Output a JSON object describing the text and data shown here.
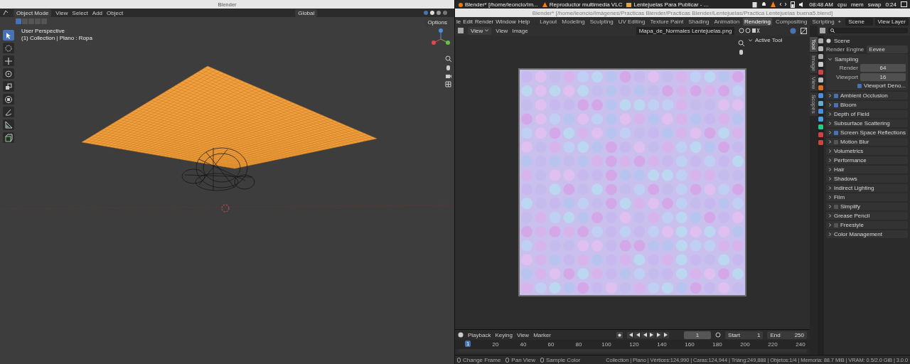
{
  "left_window": {
    "title": "Blender",
    "header": {
      "mode": "Object Mode",
      "menus": [
        "View",
        "Select",
        "Add",
        "Object"
      ],
      "orientation": "Global",
      "options": "Options"
    },
    "overlay": {
      "perspective": "User Perspective",
      "collection": "(1) Collection | Plano : Ropa"
    },
    "tools": [
      {
        "selected": true
      },
      {
        "selected": false
      },
      {
        "selected": false
      },
      {
        "selected": false
      },
      {
        "selected": false
      },
      {
        "selected": false
      },
      {
        "selected": false
      },
      {
        "selected": false
      },
      {
        "selected": false
      }
    ]
  },
  "taskbar": {
    "items": [
      "Blender* [/home/leoncio/Im...",
      "Reproductor multimedia VLC",
      "Lentejuelas Para Publicar - ..."
    ],
    "clock": "08:48 AM",
    "meters": [
      "cpu",
      "mem",
      "swap"
    ],
    "uptime": "0:24"
  },
  "right_window": {
    "title": "Blender* [/home/leoncio/Imágenes/Practicas Blender/Practicas Blender/Lentejuelas/Practica Lentejuelas buena5.blend]",
    "menus": [
      "le",
      "Edit",
      "Render",
      "Window",
      "Help"
    ],
    "workspaces": [
      {
        "label": "Layout",
        "selected": false
      },
      {
        "label": "Modeling",
        "selected": false
      },
      {
        "label": "Sculpting",
        "selected": false
      },
      {
        "label": "UV Editing",
        "selected": false
      },
      {
        "label": "Texture Paint",
        "selected": false
      },
      {
        "label": "Shading",
        "selected": false
      },
      {
        "label": "Animation",
        "selected": false
      },
      {
        "label": "Rendering",
        "selected": true
      },
      {
        "label": "Compositing",
        "selected": false
      },
      {
        "label": "Scripting",
        "selected": false
      }
    ],
    "add_tab": "+",
    "scene": "Scene",
    "view_layer": "View Layer"
  },
  "image_editor": {
    "mode": "View",
    "menus": [
      "View",
      "Image"
    ],
    "image_name": "Mapa_de_Normales Lentejuelas.png",
    "active_tool": "Active Tool",
    "sidebar_tabs": [
      {
        "label": "Tool",
        "selected": true
      },
      {
        "label": "Image",
        "selected": false
      },
      {
        "label": "View",
        "selected": false
      },
      {
        "label": "Scopes",
        "selected": false
      }
    ]
  },
  "properties": {
    "scene": "Scene",
    "render_engine_label": "Render Engine",
    "render_engine": "Eevee",
    "sampling": {
      "title": "Sampling",
      "expanded": true,
      "fields": [
        {
          "label": "Render",
          "value": "64"
        },
        {
          "label": "Viewport",
          "value": "16"
        }
      ],
      "denoise": {
        "label": "Viewport Deno...",
        "checked": true
      }
    },
    "panels": [
      {
        "title": "Ambient Occlusion",
        "kind": "checkbox",
        "checked": true
      },
      {
        "title": "Bloom",
        "kind": "checkbox",
        "checked": true
      },
      {
        "title": "Depth of Field",
        "kind": "plain"
      },
      {
        "title": "Subsurface Scattering",
        "kind": "plain"
      },
      {
        "title": "Screen Space Reflections",
        "kind": "checkbox",
        "checked": true
      },
      {
        "title": "Motion Blur",
        "kind": "checkbox",
        "checked": false
      },
      {
        "title": "Volumetrics",
        "kind": "plain"
      },
      {
        "title": "Performance",
        "kind": "plain"
      },
      {
        "title": "Hair",
        "kind": "plain"
      },
      {
        "title": "Shadows",
        "kind": "plain"
      },
      {
        "title": "Indirect Lighting",
        "kind": "plain"
      },
      {
        "title": "Film",
        "kind": "plain"
      },
      {
        "title": "Simplify",
        "kind": "checkbox",
        "checked": false
      },
      {
        "title": "Grease Pencil",
        "kind": "plain"
      },
      {
        "title": "Freestyle",
        "kind": "checkbox",
        "checked": false
      },
      {
        "title": "Color Management",
        "kind": "plain"
      }
    ]
  },
  "timeline": {
    "menus": [
      "Playback",
      "Keying",
      "View",
      "Marker"
    ],
    "current_frame": "1",
    "start_label": "Start",
    "start": "1",
    "end_label": "End",
    "end": "250",
    "playhead": "1",
    "ticks": [
      "20",
      "40",
      "60",
      "80",
      "100",
      "120",
      "140",
      "160",
      "180",
      "200",
      "220",
      "240"
    ]
  },
  "status_bar": {
    "hints": [
      "Change Frame",
      "Pan View",
      "Sample Color"
    ],
    "stats": "Collection | Plano | Vértices:124,990 | Caras:124,944 | Triáng:249,888 | Objetos:1/4 | Memoria: 88.7 MiB | VRAM: 0.5/2.0 GiB | 3.0.0"
  }
}
